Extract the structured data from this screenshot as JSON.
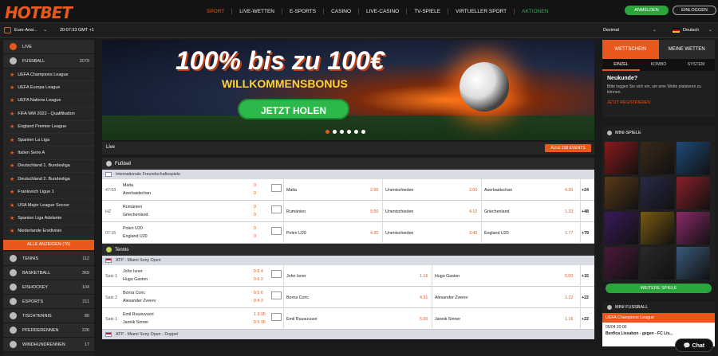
{
  "brand": {
    "logo": "HOTBET",
    "accent": "#e8571c",
    "green": "#2db84b"
  },
  "nav": [
    "SPORT",
    "LIVE-WETTEN",
    "E-SPORTS",
    "CASINO",
    "LIVE-CASINO",
    "TV-SPIELE",
    "VIRTUELLER SPORT",
    "AKTIONEN"
  ],
  "auth": {
    "login": "ANMELDEN",
    "logout": "EINLOGGEN"
  },
  "subbar": {
    "odds_region": "Euro-Ansi...",
    "time": "20:07:33 GMT +1",
    "odds_format": "Dezimal",
    "language": "Deutsch"
  },
  "sidebar": {
    "live": "LIVE",
    "football": {
      "label": "FUSSBALL",
      "count": "2079"
    },
    "leagues": [
      "UEFA Champions League",
      "UEFA Europa League",
      "UEFA Nations League",
      "FIFA WM 2022 - Qualifikation",
      "England Premier League",
      "Spanien La Liga",
      "Italien Serie A",
      "Deutschland 1. Bundesliga",
      "Deutschland 2. Bundesliga",
      "Frankreich Ligue 1",
      "USA Major League Soccer",
      "Spanien Liga Adelante",
      "Niederlande Eredivisie"
    ],
    "show_all": "ALLE ANZEIGEN (76)",
    "sports": [
      {
        "label": "TENNIS",
        "count": "112"
      },
      {
        "label": "BASKETBALL",
        "count": "369"
      },
      {
        "label": "EISHOCKEY",
        "count": "104"
      },
      {
        "label": "ESPORTS",
        "count": "211"
      },
      {
        "label": "TISCHTENNIS",
        "count": "80"
      },
      {
        "label": "PFERDERENNEN",
        "count": "226"
      },
      {
        "label": "WINDHUNDRENNEN",
        "count": "17"
      }
    ]
  },
  "banner": {
    "headline": "100% bis zu 100€",
    "sub": "WILLKOMMENSBONUS",
    "cta": "JETZT HOLEN"
  },
  "live": {
    "label": "Live",
    "all_events": "ALLE 238 EVENTS"
  },
  "football_section": {
    "title": "Fußball",
    "league": "Internationale Freundschaftsspiele",
    "matches": [
      {
        "time": "47:03",
        "home": "Malta",
        "away": "Aserbaidschan",
        "sh": "0",
        "sa": "0",
        "o1": "Malta",
        "v1": "2.95",
        "ox": "Unentschieden",
        "vx": "2.00",
        "o2": "Aserbaidschan",
        "v2": "4.30",
        "more": "+24"
      },
      {
        "time": "HZ",
        "home": "Rumänien",
        "away": "Griechenland",
        "sh": "0",
        "sa": "0",
        "o1": "Rumänien",
        "v1": "9.50",
        "ox": "Unentschieden",
        "vx": "4.10",
        "o2": "Griechenland",
        "v2": "1.33",
        "more": "+48"
      },
      {
        "time": "07:16",
        "home": "Polen U20",
        "away": "England U20",
        "sh": "0",
        "sa": "0",
        "o1": "Polen U20",
        "v1": "4.20",
        "ox": "Unentschieden",
        "vx": "3.40",
        "o2": "England U20",
        "v2": "1.77",
        "more": "+79"
      }
    ]
  },
  "tennis_section": {
    "title": "Tennis",
    "league": "ATP - Miami Sony Open",
    "league2": "ATP - Miami Sony Open - Doppel",
    "matches": [
      {
        "time": "Satz 1",
        "home": "John Isner",
        "away": "Hugo Gaston",
        "sh": "0 6 4",
        "sa": "0 6 2",
        "o1": "John Isner",
        "v1": "1.16",
        "o2": "Hugo Gaston",
        "v2": "5.00",
        "more": "+15"
      },
      {
        "time": "Satz 2",
        "home": "Borna Coric",
        "away": "Alexander Zverev",
        "sh": "0 5 6",
        "sa": "0 4 3",
        "o1": "Borna Coric",
        "v1": "4.31",
        "o2": "Alexander Zverev",
        "v2": "1.22",
        "more": "+22"
      },
      {
        "time": "Satz 1",
        "home": "Emil Ruusuvuori",
        "away": "Jannik Sinner",
        "sh": "1 3 15",
        "sa": "0 5 15",
        "o1": "Emil Ruusuvuori",
        "v1": "5.00",
        "o2": "Jannik Sinner",
        "v2": "1.16",
        "more": "+22"
      }
    ]
  },
  "betslip": {
    "tab1": "WETTSCHEIN",
    "tab2": "MEINE WETTEN",
    "sub1": "EINZEL",
    "sub2": "KOMBO",
    "sub3": "SYSTEM",
    "heading": "Neukunde?",
    "text": "Bitte loggen Sie sich ein, um eine Wette platzieren zu können.",
    "register": "JETZT REGISTRIEREN"
  },
  "mini_games": {
    "title": "MINI-SPIELE",
    "more": "WEITERE SPIELE",
    "tiles": [
      "#8a1a1a",
      "#3a2a1a",
      "#1e4a7a",
      "#5a3a1a",
      "#2a2a4a",
      "#8a1f2a",
      "#3a1a5a",
      "#7a5a10",
      "#8a2a6a",
      "#4a1a3a",
      "#2a2a2a",
      "#3a5a7a"
    ]
  },
  "mini_football": {
    "title": "MINI FUSSBALL",
    "league": "UEFA Champions League",
    "time": "05/04 20:00",
    "match": "Benfica Lissabon - gegen - FC Liv..."
  },
  "chat": "Chat"
}
